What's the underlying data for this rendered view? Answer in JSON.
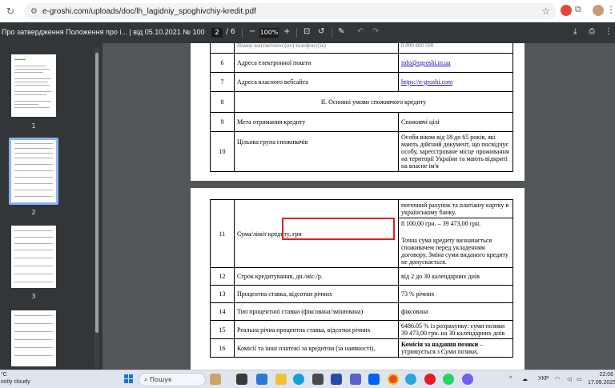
{
  "browser": {
    "url": "e-groshi.com/uploads/doc/lh_lagidniy_spoghivchiy-kredit.pdf"
  },
  "pdf_toolbar": {
    "title": "Про затвердження Положення про і... | від 05.10.2021 № 100",
    "current_page": "2",
    "page_sep": "/ 6",
    "zoom": "100%"
  },
  "sidebar": {
    "pages": [
      "1",
      "2",
      "3"
    ]
  },
  "page1_rows": [
    {
      "num": "6",
      "name": "Адреса електронної пошти",
      "value": "info@egroshi.in.ua"
    },
    {
      "num": "7",
      "name": "Адреса власного вебсайта",
      "value": "https://e-groshi.com"
    },
    {
      "num": "8",
      "section": "ІІ. Основні умови споживчого кредиту"
    },
    {
      "num": "9",
      "name": "Мета отримання кредиту",
      "value": "Споживчі цілі"
    },
    {
      "num": "10",
      "name": "Цільова група споживачів",
      "value": "Особи віком від 18 до 65 років, які мають дійсний документ, що посвідчує особу, зареєстроване місце проживання на території України та мають відкриті на власне ім'я"
    }
  ],
  "page2_rows": [
    {
      "num": "",
      "name": "",
      "value": "поточний рахунок та платіжну картку в українському банку."
    },
    {
      "num": "11",
      "name": "Сума/ліміт кредиту, грн",
      "value": "8 100,00 грн. – 39 473,00 грн.",
      "value2": "Точна сума кредиту визначається споживачем перед укладенням договору. Зміна суми виданого кредиту не допускається."
    },
    {
      "num": "12",
      "name": "Строк кредитування, дн./міс./р.",
      "value": "від 2 до 30 календарних днів"
    },
    {
      "num": "13",
      "name": "Процентна ставка, відсотки річних",
      "value": "73 % річних"
    },
    {
      "num": "14",
      "name": "Тип процентної ставки (фіксована/змінювана)",
      "value": "фіксована"
    },
    {
      "num": "15",
      "name": "Реальна річна процентна ставка, відсотки річних",
      "value": "6486.05 % із розрахунку: суми позики 39 473,00 грн. на 30 календарних днів"
    },
    {
      "num": "16",
      "name": "Комісії та інші платежі за кредитом (за наявності),",
      "value_bold": "Комісія за надання позики",
      "value": " – утримується з Суми позики,"
    }
  ],
  "taskbar": {
    "weather_temp": "°C",
    "weather_desc": "ostly cloudy",
    "search_label": "Пошук",
    "lang": "УКР",
    "time": "22:06",
    "date": "17.09.2025"
  }
}
